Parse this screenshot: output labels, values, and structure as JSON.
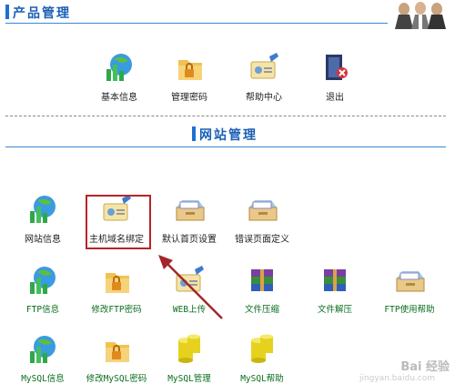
{
  "product_section": {
    "title": "产品管理"
  },
  "product_items": [
    {
      "label": "基本信息",
      "icon": "globe-chart-icon"
    },
    {
      "label": "管理密码",
      "icon": "folder-lock-icon"
    },
    {
      "label": "帮助中心",
      "icon": "edit-card-icon"
    },
    {
      "label": "退出",
      "icon": "exit-icon"
    }
  ],
  "site_section": {
    "title": "网站管理"
  },
  "site_items": [
    {
      "label": "网站信息",
      "icon": "globe-chart-icon"
    },
    {
      "label": "主机域名绑定",
      "icon": "edit-card-icon"
    },
    {
      "label": "默认首页设置",
      "icon": "drawer-icon"
    },
    {
      "label": "错误页面定义",
      "icon": "drawer-icon"
    },
    {
      "label": "FTP信息",
      "icon": "globe-chart-icon"
    },
    {
      "label": "修改FTP密码",
      "icon": "folder-lock-icon"
    },
    {
      "label": "WEB上传",
      "icon": "edit-card-icon"
    },
    {
      "label": "文件压缩",
      "icon": "archive-icon"
    },
    {
      "label": "文件解压",
      "icon": "archive-icon"
    },
    {
      "label": "FTP使用帮助",
      "icon": "drawer-icon"
    },
    {
      "label": "MySQL信息",
      "icon": "globe-chart-icon"
    },
    {
      "label": "修改MySQL密码",
      "icon": "folder-lock-icon"
    },
    {
      "label": "MySQL管理",
      "icon": "database-icon"
    },
    {
      "label": "MySQL帮助",
      "icon": "database-icon"
    }
  ],
  "watermark": {
    "main": "Bai 经验",
    "sub": "jingyan.baidu.com"
  },
  "colors": {
    "accent": "#1a5fb4",
    "highlight": "#b5252a",
    "green_label": "#0a6e1e"
  }
}
